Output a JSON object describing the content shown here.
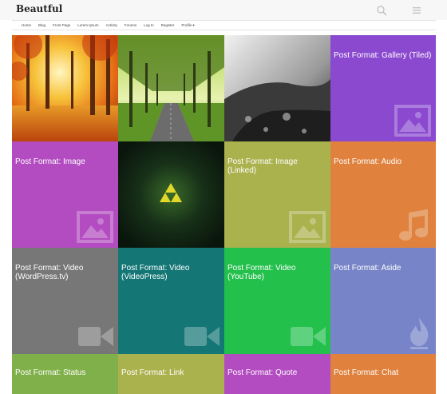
{
  "site": {
    "title": "Beautful"
  },
  "nav": [
    "Home",
    "Blog",
    "Front Page",
    "Lorem Ipsum",
    "Activity",
    "Forums",
    "Log In",
    "Register",
    "Profile ▾"
  ],
  "tiles": [
    {
      "title": "",
      "color": "#e07a1f",
      "kind": "photo-autumn"
    },
    {
      "title": "",
      "color": "#5a8a2a",
      "kind": "photo-road"
    },
    {
      "title": "",
      "color": "#888888",
      "kind": "photo-rock"
    },
    {
      "title": "Post Format: Gallery (Tiled)",
      "color": "#8a49cf",
      "icon": "gallery-icon"
    },
    {
      "title": "Post Format: Image",
      "color": "#b24cc0",
      "icon": "image-icon"
    },
    {
      "title": "",
      "color": "#17301a",
      "kind": "triforce"
    },
    {
      "title": "Post Format: Image (Linked)",
      "color": "#aab24e",
      "icon": "image-icon"
    },
    {
      "title": "Post Format: Audio",
      "color": "#e0823e",
      "icon": "music-note-icon"
    },
    {
      "title": "Post Format: Video (WordPress.tv)",
      "color": "#777777",
      "icon": "video-camera-icon"
    },
    {
      "title": "Post Format: Video (VideoPress)",
      "color": "#157676",
      "icon": "video-camera-icon"
    },
    {
      "title": "Post Format: Video (YouTube)",
      "color": "#23c04c",
      "icon": "video-camera-icon"
    },
    {
      "title": "Post Format: Aside",
      "color": "#7785c8",
      "icon": "flame-icon"
    },
    {
      "title": "Post Format: Status",
      "color": "#80b04a"
    },
    {
      "title": "Post Format: Link",
      "color": "#aab24e"
    },
    {
      "title": "Post Format: Quote",
      "color": "#b24cc0"
    },
    {
      "title": "Post Format: Chat",
      "color": "#e0823e"
    }
  ]
}
